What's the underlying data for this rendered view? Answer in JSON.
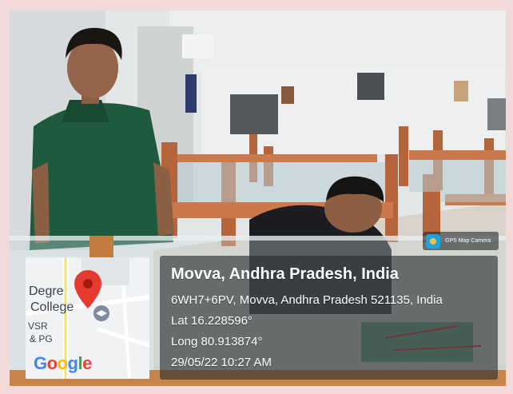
{
  "photo": {
    "description_icon": "camera-photo"
  },
  "map": {
    "labels": [
      "Degre",
      "College",
      "VSR",
      "& PG"
    ],
    "logo": "Google",
    "logo_colors": [
      "#4285F4",
      "#EA4335",
      "#FBBC05",
      "#4285F4",
      "#34A853",
      "#EA4335"
    ],
    "pin_icon": "location-pin-icon",
    "school_icon": "graduation-cap-icon"
  },
  "location": {
    "title": "Movva, Andhra Pradesh, India",
    "address": "6WH7+6PV, Movva, Andhra Pradesh 521135, India",
    "lat": "Lat 16.228596°",
    "long": "Long 80.913874°",
    "datetime": "29/05/22 10:27 AM"
  },
  "badge": {
    "label": "GPS Map Camera",
    "icon": "gps-map-camera-icon"
  }
}
